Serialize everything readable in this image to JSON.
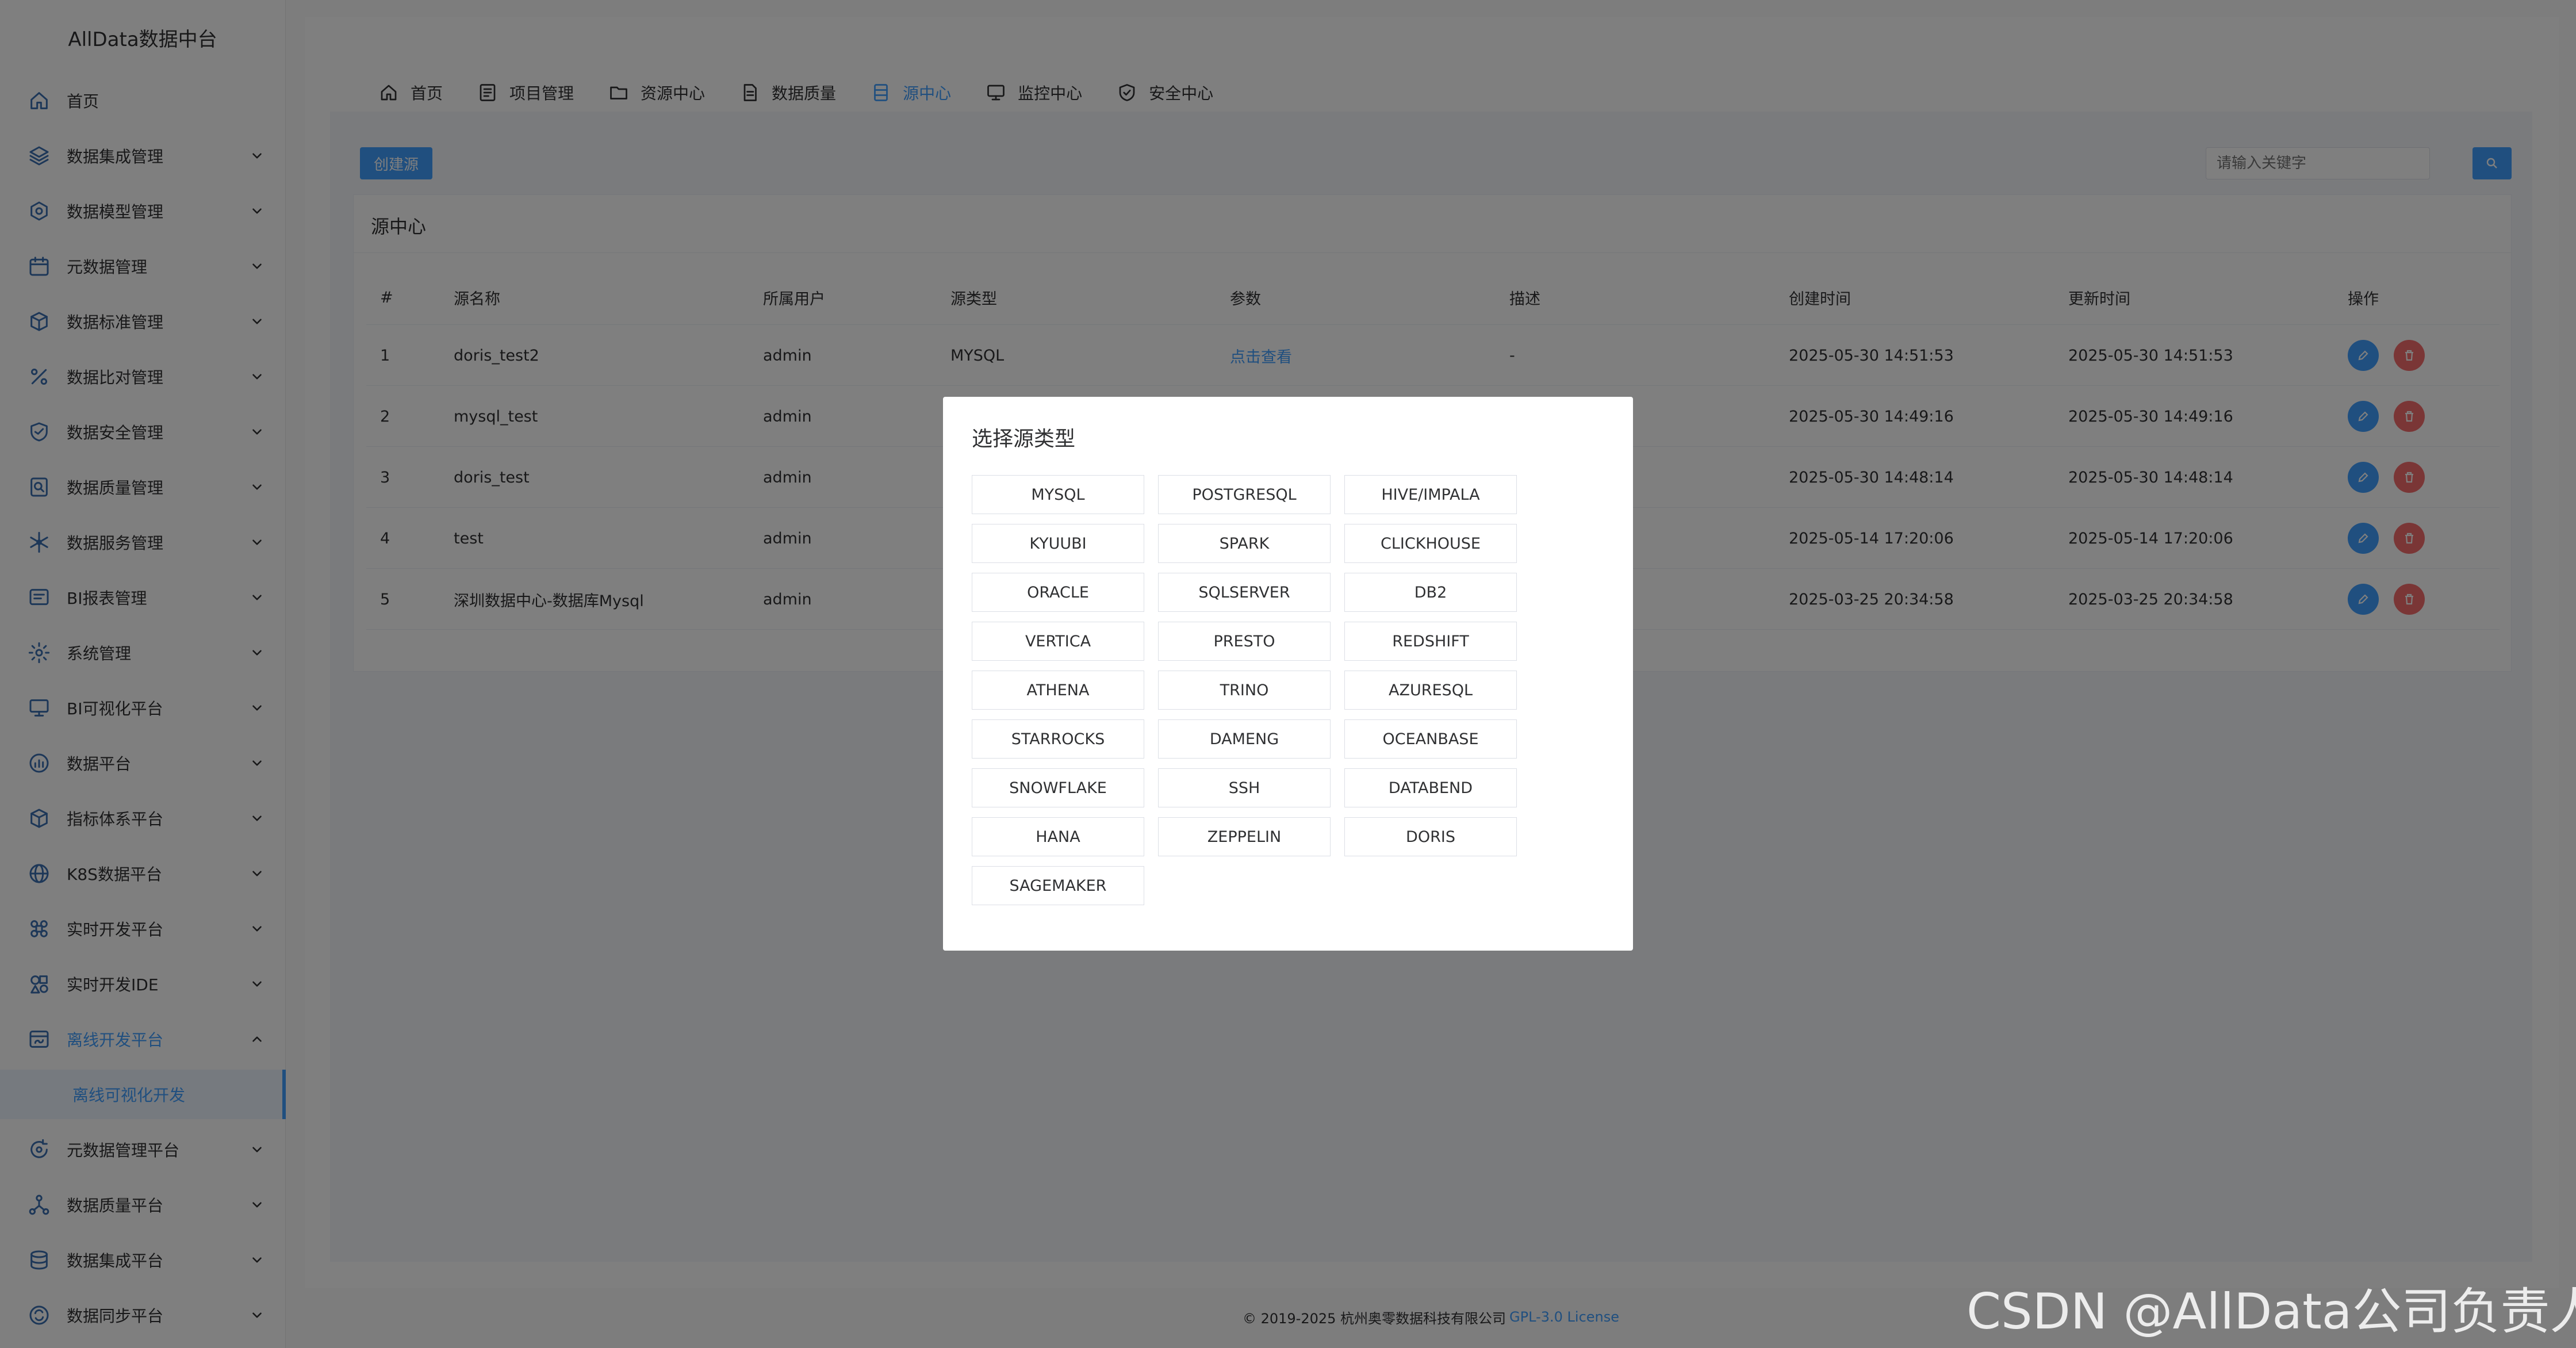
{
  "app": {
    "title": "AllData数据中台"
  },
  "sidebar": {
    "items": [
      {
        "label": "首页",
        "icon": "home-icon",
        "expandable": false
      },
      {
        "label": "数据集成管理",
        "icon": "layers-icon",
        "expandable": true
      },
      {
        "label": "数据模型管理",
        "icon": "model-icon",
        "expandable": true
      },
      {
        "label": "元数据管理",
        "icon": "calendar-icon",
        "expandable": true
      },
      {
        "label": "数据标准管理",
        "icon": "cube-icon",
        "expandable": true
      },
      {
        "label": "数据比对管理",
        "icon": "percent-icon",
        "expandable": true
      },
      {
        "label": "数据安全管理",
        "icon": "shield-icon",
        "expandable": true
      },
      {
        "label": "数据质量管理",
        "icon": "search-doc-icon",
        "expandable": true
      },
      {
        "label": "数据服务管理",
        "icon": "snowflake-icon",
        "expandable": true
      },
      {
        "label": "BI报表管理",
        "icon": "report-icon",
        "expandable": true
      },
      {
        "label": "系统管理",
        "icon": "settings-icon",
        "expandable": true
      },
      {
        "label": "BI可视化平台",
        "icon": "monitor-icon",
        "expandable": true
      },
      {
        "label": "数据平台",
        "icon": "chart-icon",
        "expandable": true
      },
      {
        "label": "指标体系平台",
        "icon": "box-icon",
        "expandable": true
      },
      {
        "label": "K8S数据平台",
        "icon": "globe-icon",
        "expandable": true
      },
      {
        "label": "实时开发平台",
        "icon": "command-icon",
        "expandable": true
      },
      {
        "label": "实时开发IDE",
        "icon": "shapes-icon",
        "expandable": true
      },
      {
        "label": "离线开发平台",
        "icon": "sql-icon",
        "expandable": true,
        "open": true
      },
      {
        "label": "元数据管理平台",
        "icon": "refresh-icon",
        "expandable": true
      },
      {
        "label": "数据质量平台",
        "icon": "network-icon",
        "expandable": true
      },
      {
        "label": "数据集成平台",
        "icon": "database-icon",
        "expandable": true
      },
      {
        "label": "数据同步平台",
        "icon": "sync-icon",
        "expandable": true
      }
    ],
    "sub_item": {
      "label": "离线可视化开发"
    }
  },
  "topnav": {
    "tabs": [
      {
        "label": "首页",
        "icon": "home-icon"
      },
      {
        "label": "项目管理",
        "icon": "list-icon"
      },
      {
        "label": "资源中心",
        "icon": "folder-icon"
      },
      {
        "label": "数据质量",
        "icon": "document-icon"
      },
      {
        "label": "源中心",
        "icon": "server-icon",
        "active": true
      },
      {
        "label": "监控中心",
        "icon": "monitor-icon"
      },
      {
        "label": "安全中心",
        "icon": "shield-check-icon"
      }
    ]
  },
  "toolbar": {
    "create_label": "创建源",
    "search_placeholder": "请输入关键字"
  },
  "card": {
    "title": "源中心"
  },
  "table": {
    "headers": [
      "#",
      "源名称",
      "所属用户",
      "源类型",
      "参数",
      "描述",
      "创建时间",
      "更新时间",
      "操作"
    ],
    "rows": [
      [
        "1",
        "doris_test2",
        "admin",
        "MYSQL",
        "点击查看",
        "-",
        "2025-05-30 14:51:53",
        "2025-05-30 14:51:53"
      ],
      [
        "2",
        "mysql_test",
        "admin",
        "",
        "",
        "",
        "2025-05-30 14:49:16",
        "2025-05-30 14:49:16"
      ],
      [
        "3",
        "doris_test",
        "admin",
        "",
        "",
        "",
        "2025-05-30 14:48:14",
        "2025-05-30 14:48:14"
      ],
      [
        "4",
        "test",
        "admin",
        "",
        "",
        "",
        "2025-05-14 17:20:06",
        "2025-05-14 17:20:06"
      ],
      [
        "5",
        "深圳数据中心-数据库Mysql",
        "admin",
        "",
        "",
        "",
        "2025-03-25 20:34:58",
        "2025-03-25 20:34:58"
      ]
    ]
  },
  "dialog": {
    "title": "选择源类型",
    "types": [
      "MYSQL",
      "POSTGRESQL",
      "HIVE/IMPALA",
      "KYUUBI",
      "SPARK",
      "CLICKHOUSE",
      "ORACLE",
      "SQLSERVER",
      "DB2",
      "VERTICA",
      "PRESTO",
      "REDSHIFT",
      "ATHENA",
      "TRINO",
      "AZURESQL",
      "STARROCKS",
      "DAMENG",
      "OCEANBASE",
      "SNOWFLAKE",
      "SSH",
      "DATABEND",
      "HANA",
      "ZEPPELIN",
      "DORIS",
      "SAGEMAKER"
    ]
  },
  "footer": {
    "copyright": "© 2019-2025 杭州奥零数据科技有限公司",
    "license": "GPL-3.0 License"
  },
  "watermark": {
    "text": "CSDN @AllData公司负责人"
  },
  "colors": {
    "primary": "#409eff",
    "danger": "#f56c6c",
    "overlay": "rgba(0,0,0,0.5)"
  }
}
